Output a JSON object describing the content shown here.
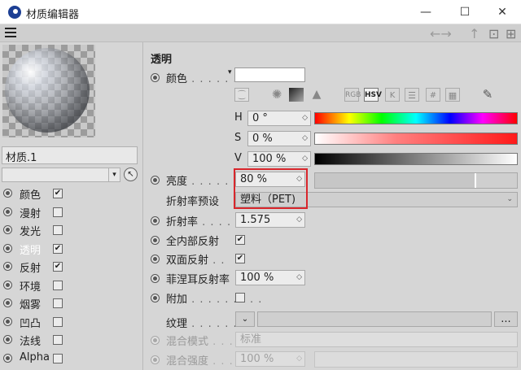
{
  "window": {
    "title": "材质编辑器",
    "minimize": "—",
    "maximize": "☐",
    "close": "✕"
  },
  "menubar": {
    "back": "←→",
    "up": "↑",
    "lock": "⊡",
    "new": "⊞"
  },
  "material": {
    "name": "材质.1"
  },
  "channels": [
    {
      "label": "颜色",
      "checked": true,
      "active": false
    },
    {
      "label": "漫射",
      "checked": false,
      "active": false
    },
    {
      "label": "发光",
      "checked": false,
      "active": false
    },
    {
      "label": "透明",
      "checked": true,
      "active": true
    },
    {
      "label": "反射",
      "checked": true,
      "active": false
    },
    {
      "label": "环境",
      "checked": false,
      "active": false
    },
    {
      "label": "烟雾",
      "checked": false,
      "active": false
    },
    {
      "label": "凹凸",
      "checked": false,
      "active": false
    },
    {
      "label": "法线",
      "checked": false,
      "active": false
    },
    {
      "label": "Alpha",
      "checked": false,
      "active": false
    }
  ],
  "section": {
    "title": "透明",
    "color_label": "颜色",
    "color_value": "#ffffff",
    "h_label": "H",
    "h_value": "0 °",
    "s_label": "S",
    "s_value": "0 %",
    "v_label": "V",
    "v_value": "100 %",
    "brightness_label": "亮度",
    "brightness_value": "80 %",
    "brightness_fraction": 0.8,
    "ior_preset_label": "折射率预设",
    "ior_preset_value": "塑料（PET)",
    "ior_label": "折射率",
    "ior_value": "1.575",
    "total_internal_label": "全内部反射",
    "total_internal_checked": true,
    "double_sided_label": "双面反射",
    "double_sided_checked": true,
    "fresnel_label": "菲涅耳反射率",
    "fresnel_value": "100 %",
    "additive_label": "附加",
    "additive_checked": false,
    "texture_label": "纹理",
    "texture_more": "...",
    "blend_mode_label": "混合模式",
    "blend_mode_value": "标准",
    "blend_strength_label": "混合强度",
    "blend_strength_value": "100 %"
  },
  "colortools": {
    "rgb": "RGB",
    "hsv": "HSV",
    "k": "K",
    "hex": "#"
  },
  "colors": {
    "highlight": "#d9262c",
    "panel": "#d6d6d6"
  }
}
